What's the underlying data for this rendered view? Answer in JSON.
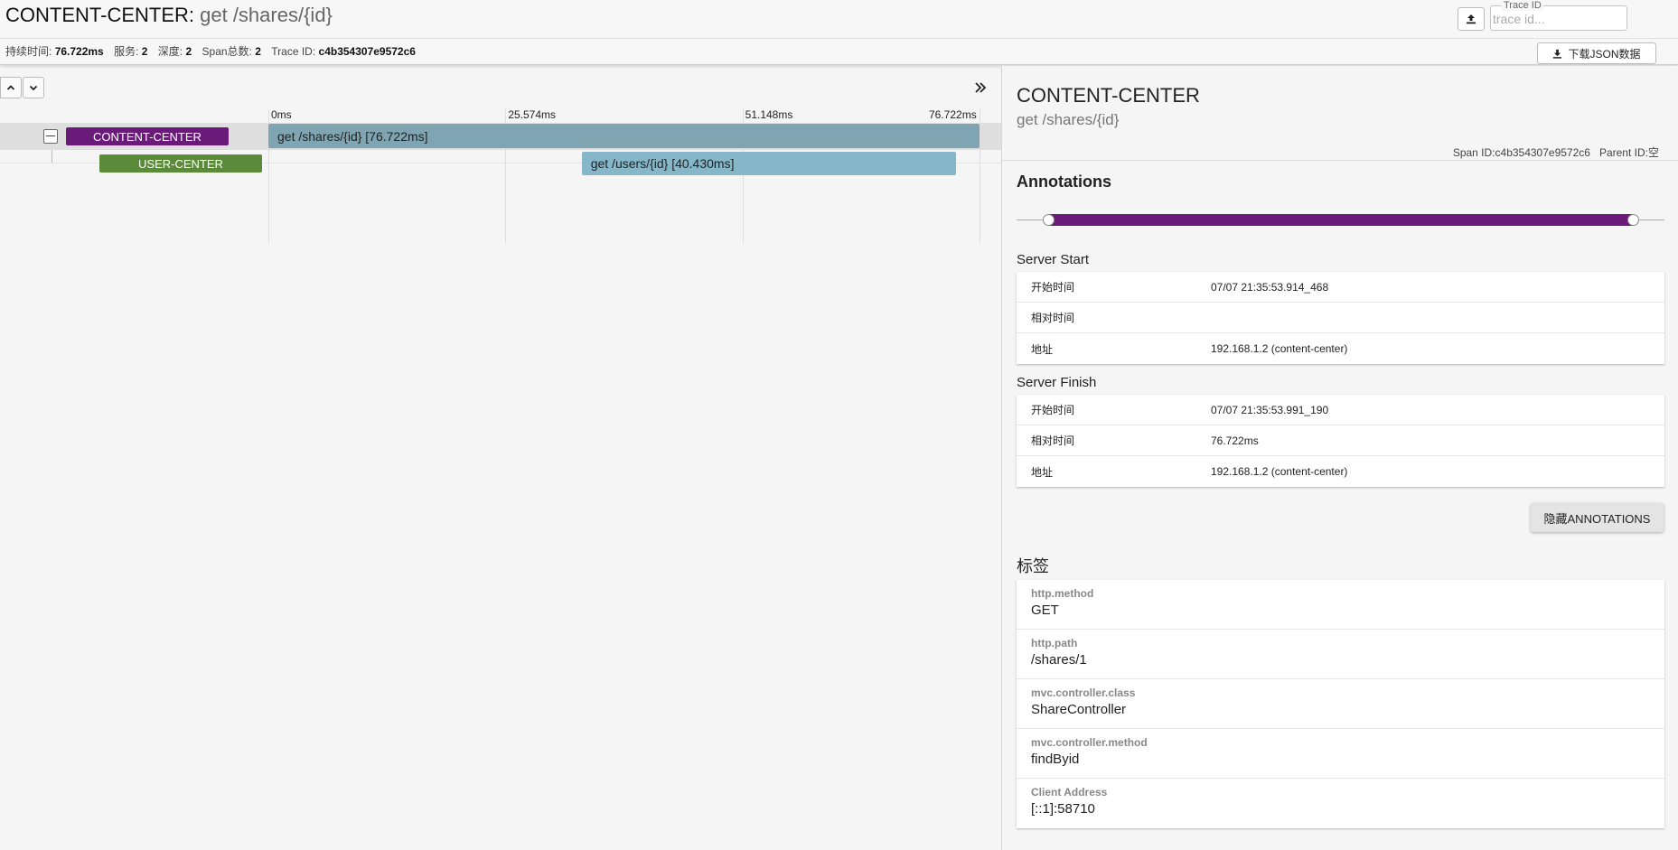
{
  "header": {
    "service": "CONTENT-CENTER",
    "separator": ":",
    "operation": " get /shares/{id}",
    "stats": [
      {
        "label": "持续时间:",
        "value": "76.722ms"
      },
      {
        "label": "服务:",
        "value": "2"
      },
      {
        "label": "深度:",
        "value": "2"
      },
      {
        "label": "Span总数:",
        "value": "2"
      },
      {
        "label": "Trace ID:",
        "value": "c4b354307e9572c6"
      }
    ],
    "trace_id_label": "Trace ID",
    "trace_id_placeholder": "trace id...",
    "download_label": "下载JSON数据",
    "icons": {
      "upload": "upload-icon",
      "download": "download-icon"
    }
  },
  "timeline": {
    "ticks": [
      "0ms",
      "25.574ms",
      "51.148ms",
      "76.722ms"
    ],
    "total_ms": 76.722,
    "spans": [
      {
        "service": "CONTENT-CENTER",
        "label": "get /shares/{id} [76.722ms]",
        "start_ms": 0,
        "duration_ms": 76.722,
        "service_color": "#6a1b7a",
        "bar_color": "#7fa5b2"
      },
      {
        "service": "USER-CENTER",
        "label": "get /users/{id} [40.430ms]",
        "start_ms": 33.8,
        "duration_ms": 40.43,
        "service_color": "#5a8a3a",
        "bar_color": "#86b7c9"
      }
    ]
  },
  "detail": {
    "service": "CONTENT-CENTER",
    "operation": "get /shares/{id}",
    "span_id_label": "Span ID:",
    "span_id": "c4b354307e9572c6",
    "parent_id_label": "Parent ID:",
    "parent_id": "空",
    "annotations_title": "Annotations",
    "annotation_groups": [
      {
        "title": "Server Start",
        "rows": [
          {
            "key": "开始时间",
            "value": "07/07 21:35:53.914_468"
          },
          {
            "key": "相对时间",
            "value": ""
          },
          {
            "key": "地址",
            "value": "192.168.1.2 (content-center)"
          }
        ]
      },
      {
        "title": "Server Finish",
        "rows": [
          {
            "key": "开始时间",
            "value": "07/07 21:35:53.991_190"
          },
          {
            "key": "相对时间",
            "value": "76.722ms"
          },
          {
            "key": "地址",
            "value": "192.168.1.2 (content-center)"
          }
        ]
      }
    ],
    "hide_annotations_label": "隐藏ANNOTATIONS",
    "tags_title": "标签",
    "tags": [
      {
        "key": "http.method",
        "value": "GET"
      },
      {
        "key": "http.path",
        "value": "/shares/1"
      },
      {
        "key": "mvc.controller.class",
        "value": "ShareController"
      },
      {
        "key": "mvc.controller.method",
        "value": "findByid"
      },
      {
        "key": "Client Address",
        "value": "[::1]:58710"
      }
    ]
  }
}
